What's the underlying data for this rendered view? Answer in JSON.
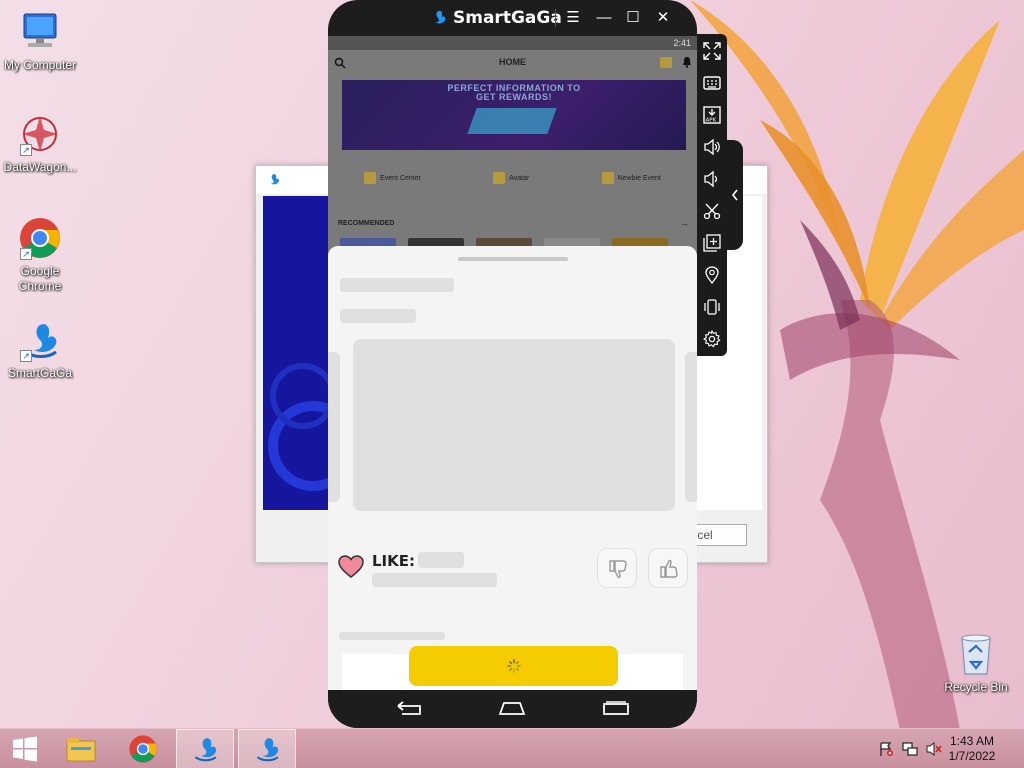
{
  "desktop": {
    "icons": [
      {
        "label": "My Computer"
      },
      {
        "label": "DataWagon..."
      },
      {
        "label": "Google Chrome"
      },
      {
        "label": "SmartGaGa"
      }
    ],
    "recycle_bin": {
      "label": "Recycle Bin"
    }
  },
  "background_dialog": {
    "cancel_label": "ancel"
  },
  "emulator": {
    "brand": "SmartGaGa",
    "controls": {
      "menu": "☰",
      "minimize": "—",
      "maximize": "☐",
      "close": "✕"
    },
    "status_time": "2:41",
    "app": {
      "header_title": "HOME",
      "banner_text_line1": "PERFECT INFORMATION TO",
      "banner_text_line2": "GET REWARDS!",
      "menu": [
        {
          "label": "Event Center"
        },
        {
          "label": "Avatar"
        },
        {
          "label": "Newbie Event"
        }
      ],
      "recommended_label": "RECOMMENDED",
      "like_label": "LIKE:"
    }
  },
  "taskbar": {
    "time": "1:43 AM",
    "date": "1/7/2022"
  },
  "colors": {
    "accent_yellow": "#f5cc00",
    "brand_blue": "#1e88e5",
    "heart_pink": "#f08a9a"
  }
}
